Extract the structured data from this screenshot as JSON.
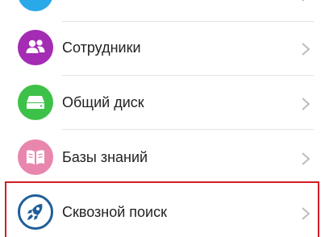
{
  "menu": {
    "items": [
      {
        "label": "",
        "icon": "blue-app-icon",
        "color": "#29a9e8"
      },
      {
        "label": "Сотрудники",
        "icon": "people-icon",
        "color": "#a42bb4"
      },
      {
        "label": "Общий диск",
        "icon": "drive-icon",
        "color": "#3ec149"
      },
      {
        "label": "Базы знаний",
        "icon": "book-icon",
        "color": "#e986ad"
      },
      {
        "label": "Сквозной поиск",
        "icon": "rocket-icon",
        "color": "#1f5f9a"
      }
    ],
    "highlighted_item": "Сквозной поиск",
    "highlight_color": "#d31c24"
  }
}
